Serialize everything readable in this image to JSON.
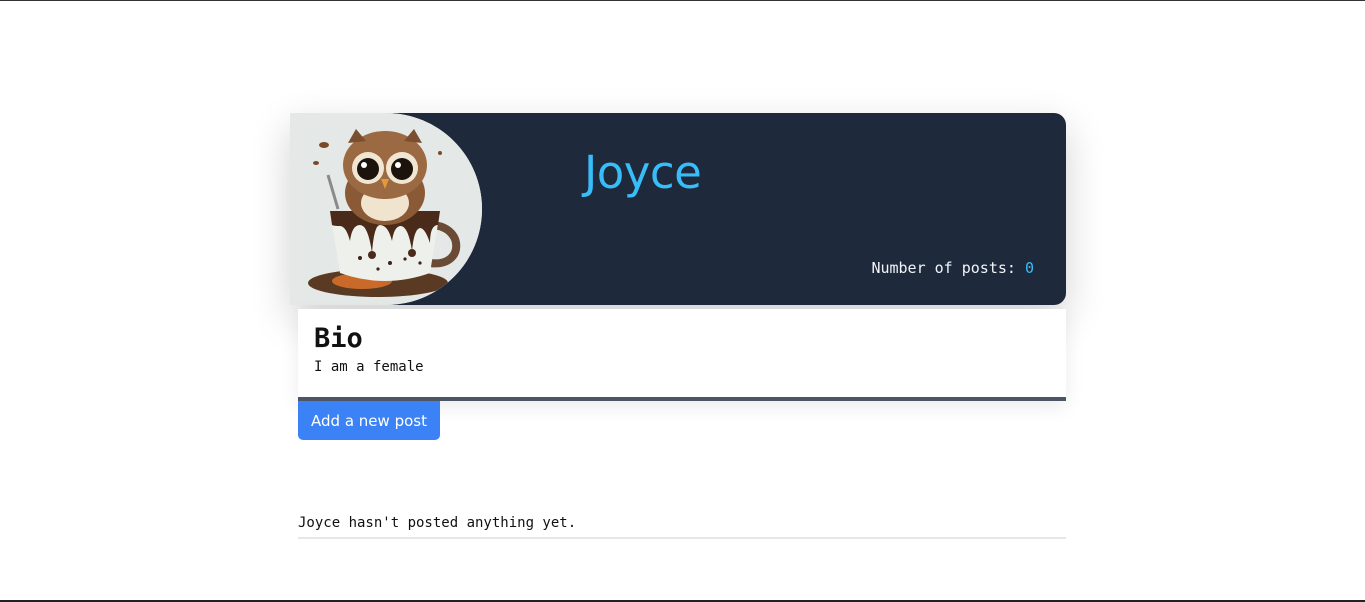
{
  "profile": {
    "username": "Joyce",
    "post_count_label": "Number of posts:",
    "post_count": "0",
    "avatar_icon": "owl-in-coffee-cup",
    "accent_color": "#38bdf8",
    "card_bg": "#1e293b"
  },
  "bio": {
    "title": "Bio",
    "text": "I am a female"
  },
  "actions": {
    "add_post_label": "Add a new post",
    "button_color": "#3b82f6"
  },
  "posts": {
    "empty_message": "Joyce hasn't posted anything yet."
  }
}
